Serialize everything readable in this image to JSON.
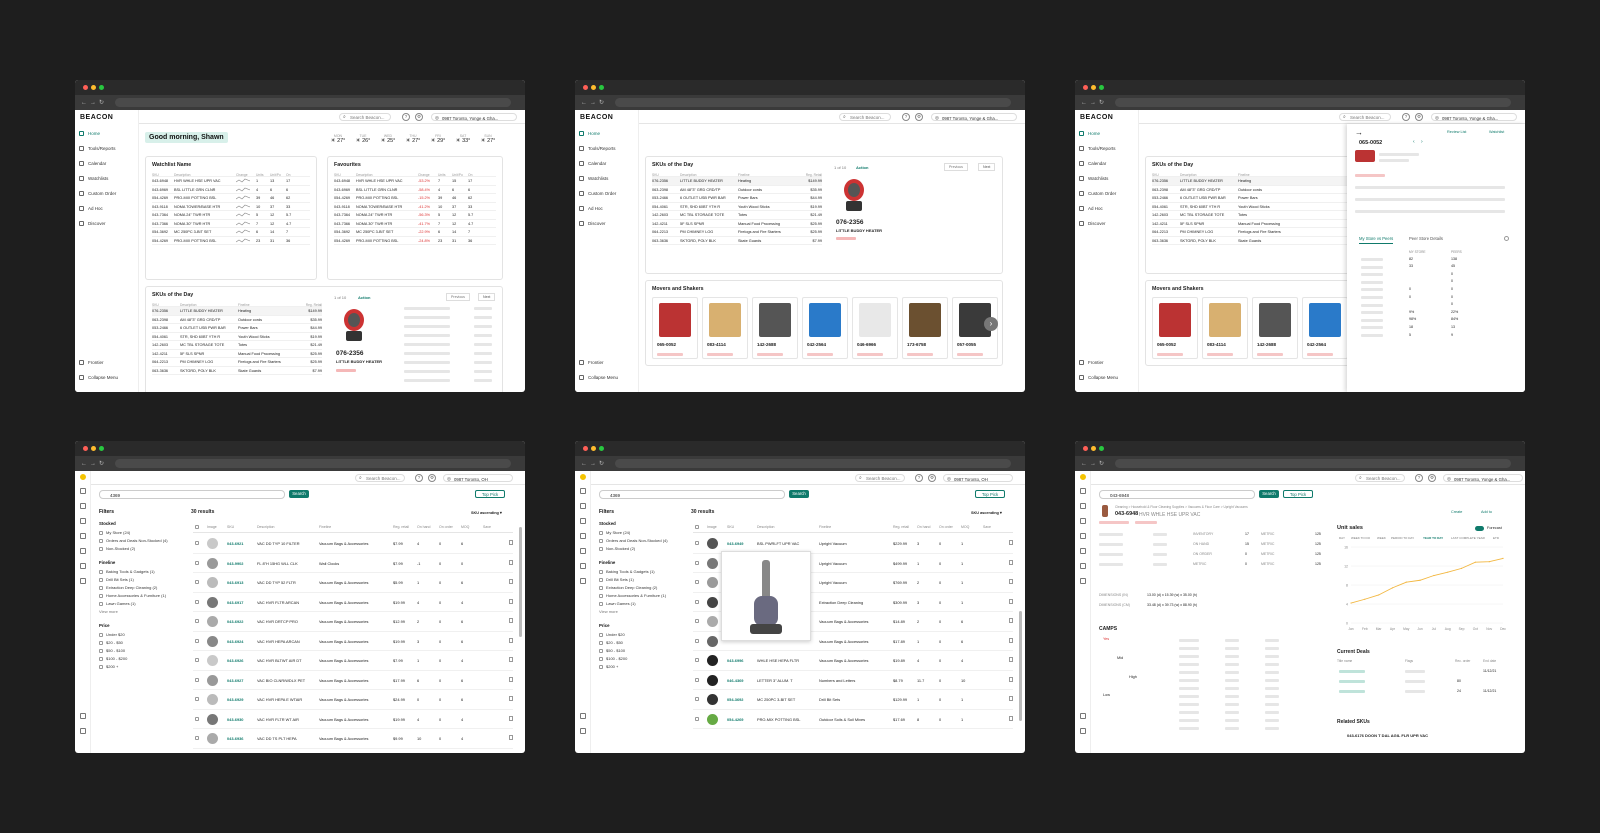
{
  "common": {
    "logo": "BEACON",
    "search_placeholder": "Search Beacon...",
    "store_ohio": "0987 Toronto, OH",
    "store_long": "0987 Toronto, Yonge & Gha...",
    "nav": [
      "Home",
      "Tools/Reports",
      "Calendar",
      "Watchlists",
      "Custom Order",
      "Ad Hoc",
      "Discover"
    ],
    "nav_bottom": [
      "Frontier",
      "Collapse Menu"
    ]
  },
  "win1": {
    "greeting": "Good morning, Shawn",
    "weather": [
      {
        "day": "MON",
        "temp": "27°"
      },
      {
        "day": "TUE",
        "temp": "26°"
      },
      {
        "day": "WED",
        "temp": "25°"
      },
      {
        "day": "THU",
        "temp": "27°"
      },
      {
        "day": "FRI",
        "temp": "29°"
      },
      {
        "day": "SAT",
        "temp": "33°"
      },
      {
        "day": "SUN",
        "temp": "27°"
      }
    ],
    "watchlist_title": "Watchlist Name",
    "favourites_title": "Favourites",
    "list_cols": [
      "SKU",
      "Description",
      "Change",
      "Units",
      "Unit/Po",
      "On"
    ],
    "watch_rows": [
      [
        "043-6948",
        "HVR WHLE HSE UPR VAC",
        "",
        "1",
        "13",
        "17"
      ],
      [
        "043-6969",
        "BSL LITTLE GRN CLNR",
        "",
        "4",
        "6",
        "6"
      ],
      [
        "054-4269",
        "PRO-MIX POTTING BSL",
        "",
        "39",
        "46",
        "62"
      ],
      [
        "043-9118",
        "NOMA TOWER/BASE HTR",
        "",
        "10",
        "37",
        "33"
      ],
      [
        "043-7364",
        "NOMA 24\" TWR HTR",
        "",
        "5",
        "12",
        "5.7"
      ],
      [
        "043-7366",
        "NOMA 30\" TWR HTR",
        "",
        "7",
        "12",
        "4.7"
      ],
      [
        "054-3692",
        "MC 250PC 3-BIT SET",
        "",
        "6",
        "14",
        "7"
      ],
      [
        "054-4269",
        "PRO-MIX POTTING BSL",
        "",
        "23",
        "31",
        "36"
      ]
    ],
    "fav_rows": [
      [
        "043-6948",
        "HVR WHLE HSE UPR VAC",
        "-53.2%",
        "7",
        "15",
        "17"
      ],
      [
        "043-6969",
        "BSL LITTLE GRN CLNR",
        "-58.4%",
        "4",
        "6",
        "6"
      ],
      [
        "054-4269",
        "PRO-MIX POTTING BSL",
        "-15.2%",
        "39",
        "46",
        "62"
      ],
      [
        "043-9118",
        "NOMA TOWER/BASE HTR",
        "-41.2%",
        "10",
        "37",
        "33"
      ],
      [
        "043-7364",
        "NOMA 24\" TWR HTR",
        "-56.3%",
        "5",
        "12",
        "5.7"
      ],
      [
        "043-7366",
        "NOMA 30\" TWR HTR",
        "-41.7%",
        "7",
        "12",
        "4.7"
      ],
      [
        "054-3692",
        "MC 250PC 3-BIT SET",
        "-22.9%",
        "6",
        "14",
        "7"
      ],
      [
        "054-4269",
        "PRO-MIX POTTING BSL",
        "-24.8%",
        "23",
        "31",
        "36"
      ]
    ],
    "skus_title": "SKUs of the Day",
    "skus_cols": [
      "SKU",
      "Description",
      "Fineline",
      "Reg. Retail"
    ],
    "skus_rows": [
      [
        "076-2356",
        "LITTLE BUDDY HEATER",
        "Heating",
        "$149.99"
      ],
      [
        "063-2398",
        "AM 48\"3\" GRD CRD/TP",
        "Outdoor cords",
        "$35.99"
      ],
      [
        "053-2466",
        "6 OUTLET USB PWR BAR",
        "Power Bars",
        "$44.99"
      ],
      [
        "054-4061",
        "STR, SHD 60BT YTH R",
        "Youth Wood Sticks",
        "$19.99"
      ],
      [
        "142-2603",
        "MC TBL STORAGE TOTE",
        "Totes",
        "$21.49"
      ],
      [
        "142-4211",
        "5F SLS SPNR",
        "Manual Food Processing",
        "$25.99"
      ],
      [
        "064-2213",
        "PM CHIMNEY LOG",
        "Firelogs and Fire Starters",
        "$25.99"
      ],
      [
        "063-3636",
        "SKTGRD, POLY BLK",
        "Skate Guards",
        "$7.99"
      ]
    ],
    "pager": "1 of 10",
    "action": "Action",
    "prev": "Previous",
    "next": "Next",
    "featured_sku": "076-2356",
    "featured_name": "LITTLE BUDDY HEATER"
  },
  "win2": {
    "movers_title": "Movers and Shakers",
    "movers": [
      {
        "sku": "065-0052",
        "color": "#b33"
      },
      {
        "sku": "083-4114",
        "color": "#d8b070"
      },
      {
        "sku": "142-2688",
        "color": "#555"
      },
      {
        "sku": "042-2564",
        "color": "#2a7ac9"
      },
      {
        "sku": "046-6966",
        "color": "#e8e8e8"
      },
      {
        "sku": "173-6758",
        "color": "#6b5030"
      },
      {
        "sku": "057-0055",
        "color": "#3a3a3a"
      }
    ]
  },
  "win3": {
    "sku": "065-0052",
    "tabs": [
      "My Store vs Peers",
      "Peer Store Details"
    ],
    "watchlist_btn": "Watchlist",
    "review_btn": "Review List",
    "movers_title": "Movers and Shakers",
    "peer_cols": [
      "MY STORE",
      "PEERS"
    ],
    "peer_vals": [
      [
        "82",
        "138"
      ],
      [
        "33",
        "45"
      ],
      [
        "",
        "0"
      ],
      [
        "",
        "0"
      ],
      [
        "0",
        "0"
      ],
      [
        "0",
        "0"
      ],
      [
        "",
        "0"
      ],
      [
        "9%",
        "22%"
      ],
      [
        "98%",
        "84%"
      ],
      [
        "18",
        "13"
      ],
      [
        "5",
        "9"
      ]
    ]
  },
  "win4": {
    "query": "4369",
    "search_btn": "Search",
    "top_pick": "Top Pick",
    "results": "30 results",
    "sort": "SKU ascending",
    "filters_title": "Filters",
    "stocked_title": "Stocked",
    "stocked": [
      "My Store (24)",
      "Orders and Deals Non-Stocked (4)",
      "Non-Stocked (2)"
    ],
    "fineline_title": "Fineline",
    "fineline": [
      "Baking Tools & Gadgets (1)",
      "Drill Bit Sets (1)",
      "Extraction Deep Cleaning (2)",
      "Home Accessories & Furniture (1)",
      "Lawn Games (1)"
    ],
    "view_more": "View more",
    "price_title": "Price",
    "prices": [
      "Under $20",
      "$20 - $50",
      "$50 - $100",
      "$100 - $200",
      "$200 +"
    ],
    "cols": [
      "Image",
      "SKU",
      "Description",
      "Fineline",
      "Reg. retail",
      "On hand",
      "On order",
      "MOQ",
      "Save"
    ],
    "rows": [
      [
        "043-6921",
        "VAC DD TYP 10 FILTER",
        "Vacuum Bags & Accessories",
        "$7.99",
        "4",
        "0",
        "6"
      ],
      [
        "043-9902",
        "FL 8\"H 15HG WLL CLK",
        "Wall Clocks",
        "$7.99",
        "-1",
        "0",
        "0"
      ],
      [
        "043-6913",
        "VAC DD TYP 52 FLTR",
        "Vacuum Bags & Accessories",
        "$5.99",
        "1",
        "0",
        "6"
      ],
      [
        "043-6917",
        "VAC HVR FLTR ARCAN",
        "Vacuum Bags & Accessories",
        "$19.99",
        "4",
        "0",
        "4"
      ],
      [
        "043-6922",
        "VAC HVR DRTCP PRO",
        "Vacuum Bags & Accessories",
        "$12.99",
        "2",
        "0",
        "6"
      ],
      [
        "043-6924",
        "VAC HVR HEPA ARCAN",
        "Vacuum Bags & Accessories",
        "$19.99",
        "3",
        "0",
        "6"
      ],
      [
        "043-6926",
        "VAC HVR BLTWT AIR DT",
        "Vacuum Bags & Accessories",
        "$7.99",
        "1",
        "0",
        "4"
      ],
      [
        "043-6927",
        "VAC BIO CLNR/WDLX PET",
        "Vacuum Bags & Accessories",
        "$17.99",
        "6",
        "0",
        "6"
      ],
      [
        "043-6929",
        "VAC HVR HEPA E WTAIR",
        "Vacuum Bags & Accessories",
        "$24.99",
        "0",
        "0",
        "6"
      ],
      [
        "043-6930",
        "VAC HVR FLTR WT AIR",
        "Vacuum Bags & Accessories",
        "$19.99",
        "4",
        "0",
        "4"
      ],
      [
        "043-6936",
        "VAC DD TS PLT HEPA",
        "Vacuum Bags & Accessories",
        "$9.99",
        "10",
        "0",
        "4"
      ]
    ]
  },
  "win5": {
    "rows": [
      [
        "043-6949",
        "BSL PWRLFT UPR VAC",
        "Upright Vacuum",
        "$229.99",
        "3",
        "0",
        "1"
      ],
      [
        "",
        "",
        "Upright Vacuum",
        "$499.99",
        "1",
        "0",
        "1"
      ],
      [
        "",
        "",
        "Upright Vacuum",
        "$769.99",
        "2",
        "0",
        "1"
      ],
      [
        "",
        "",
        "Extraction Deep Cleaning",
        "$309.99",
        "3",
        "0",
        "1"
      ],
      [
        "",
        "",
        "Vacuum Bags & Accessories",
        "$14.89",
        "2",
        "0",
        "6"
      ],
      [
        "",
        "",
        "Vacuum Bags & Accessories",
        "$17.89",
        "1",
        "0",
        "6"
      ],
      [
        "043-6996",
        "WHLE HSE HEPA FLTR",
        "Vacuum Bags & Accessories",
        "$19.89",
        "4",
        "0",
        "4"
      ],
      [
        "046-4369",
        "LETTER 3\" ALUM. T",
        "Numbers and Letters",
        "$8.79",
        "11.7",
        "0",
        "10"
      ],
      [
        "054-3692",
        "MC 250PC 3-BIT SET",
        "Drill Bit Sets",
        "$129.99",
        "1",
        "0",
        "1"
      ],
      [
        "054-4269",
        "PRO-MIX POTTING BSL",
        "Outdoor Soils & Soil Mixes",
        "$17.69",
        "8",
        "0",
        "1"
      ]
    ]
  },
  "win6": {
    "query": "043-6948",
    "breadcrumb": "Cleaning > Household & Floor Cleaning Supplies > Vacuums & Floor Care > Upright Vacuums",
    "title": "043-6948",
    "name": "HVR WHLE HSE UPR VAC",
    "create": "Create",
    "add_to": "Add to",
    "unit_sales": "Unit sales",
    "forecast": "Forecast",
    "periods": [
      "DAY",
      "WEEK TO DO",
      "WEEK",
      "PERIOD TO DAY",
      "YEAR TO DAY",
      "LAST COMPLETE YEAR",
      "ETD"
    ],
    "y_ticks": [
      "16",
      "12",
      "8",
      "4",
      "0"
    ],
    "months": [
      "Jan",
      "Feb",
      "Mar",
      "Apr",
      "May",
      "Jun",
      "Jul",
      "Aug",
      "Sep",
      "Oct",
      "Nov",
      "Dec"
    ],
    "sales": [
      4.2,
      5.0,
      5.9,
      7.4,
      8.6,
      9.0,
      10.0,
      10.7,
      11.5,
      12.8,
      12.9,
      13.6
    ],
    "stats_left": [
      [
        "INVENTORY",
        "17"
      ],
      [
        "ON HAND",
        "15"
      ],
      [
        "ON ORDER",
        "0"
      ],
      [
        "METRIC",
        "0"
      ]
    ],
    "stats_right": [
      [
        "METRIC",
        "125"
      ],
      [
        "METRIC",
        "125"
      ],
      [
        "METRIC",
        "125"
      ],
      [
        "METRIC",
        "125"
      ]
    ],
    "dims1_label": "DIMENSIONS (IN)",
    "dims1": "13.00 (d) x 15.39 (w) x 35.00 (h)",
    "dims2_label": "DIMENSIONS (CM)",
    "dims2": "33.48 (d) x 39.73 (w) x 88.90 (h)",
    "camps": "CAMPS",
    "camps_levels": [
      "Yes",
      "Mid",
      "High",
      "Low"
    ],
    "current_deals": "Current Deals",
    "deal_cols": [
      "Title name",
      "Flags",
      "Rec. order",
      "End date"
    ],
    "deals": [
      [
        "",
        "",
        "",
        "11/12/21"
      ],
      [
        "",
        "",
        "80",
        ""
      ],
      [
        "",
        "",
        "24",
        "11/12/21"
      ]
    ],
    "related": "Related SKUs",
    "related_first": "043-6176 DOON T DAL AGIL FLR UPR VAC"
  }
}
